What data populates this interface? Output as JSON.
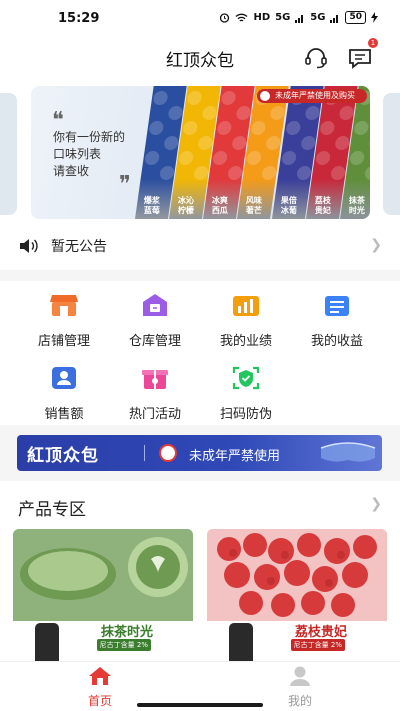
{
  "status_bar": {
    "time": "15:29",
    "net": "HD",
    "signal1": "5G",
    "signal2": "5G",
    "battery": "50"
  },
  "header": {
    "title": "红顶众包",
    "message_badge": "1"
  },
  "banner": {
    "line1": "你有一份新的",
    "line2": "口味列表",
    "line3": "请查收",
    "warning": "未成年严禁使用及购买",
    "flavors": [
      {
        "line1": "爆浆",
        "line2": "蓝莓",
        "color": "#2b4fa0"
      },
      {
        "line1": "冰沁",
        "line2": "柠檬",
        "color": "#f2b705"
      },
      {
        "line1": "冰爽",
        "line2": "西瓜",
        "color": "#e2393b"
      },
      {
        "line1": "风味",
        "line2": "著芒",
        "color": "#f49b18"
      },
      {
        "line1": "果倍",
        "line2": "冰葡",
        "color": "#3a3f9a"
      },
      {
        "line1": "荔枝",
        "line2": "贵妃",
        "color": "#c8283a"
      },
      {
        "line1": "抹茶",
        "line2": "时光",
        "color": "#5f8f3b"
      }
    ]
  },
  "notice": {
    "text": "暂无公告"
  },
  "menu": [
    {
      "label": "店铺管理",
      "icon": "store-icon",
      "color": "#f06a2a"
    },
    {
      "label": "仓库管理",
      "icon": "warehouse-icon",
      "color": "#9b5de5"
    },
    {
      "label": "我的业绩",
      "icon": "performance-chart-icon",
      "color": "#f59e0b"
    },
    {
      "label": "我的收益",
      "icon": "earnings-icon",
      "color": "#3b82f6"
    },
    {
      "label": "销售额",
      "icon": "user-sales-icon",
      "color": "#3b6fe0"
    },
    {
      "label": "热门活动",
      "icon": "gift-icon",
      "color": "#ec4899"
    },
    {
      "label": "扫码防伪",
      "icon": "scan-shield-icon",
      "color": "#22c55e"
    }
  ],
  "promo": {
    "logo": "紅顶众包",
    "text": "未成年严禁使用"
  },
  "section": {
    "title": "产品专区"
  },
  "products": [
    {
      "name": "抹茶时光",
      "tag": "尼古丁含量 2%",
      "accent": "#3a7d2c",
      "bg": "#9dbf8a"
    },
    {
      "name": "荔枝贵妃",
      "tag": "尼古丁含量 2%",
      "accent": "#c62828",
      "bg": "#e8a3a3"
    }
  ],
  "tabs": [
    {
      "label": "首页",
      "active": true,
      "color": "#e53935"
    },
    {
      "label": "我的",
      "active": false,
      "color": "#999999"
    }
  ]
}
